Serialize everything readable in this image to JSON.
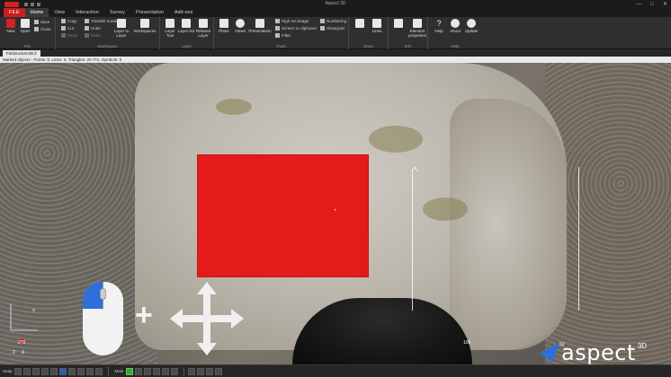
{
  "window": {
    "title": "Aspect 3D",
    "controls": [
      "—",
      "□",
      "✕"
    ]
  },
  "tabs": [
    {
      "label": "FILE"
    },
    {
      "label": "Home"
    },
    {
      "label": "View"
    },
    {
      "label": "Interaction"
    },
    {
      "label": "Survey"
    },
    {
      "label": "Presentation"
    },
    {
      "label": "Add-ons"
    }
  ],
  "ribbon": {
    "groups": {
      "file": {
        "title": "Info",
        "new": "New",
        "open": "Open",
        "save": "Save",
        "close": "Close"
      },
      "workspace": {
        "title": "Workspace",
        "copy": "Copy",
        "cut": "Cut",
        "paste": "Paste",
        "undo": "Undo",
        "redo": "Redo",
        "transfer": "Transfer mode",
        "layers": "Layer to Layer",
        "workspaces": "Workspaces"
      },
      "layer": {
        "title": "Layer",
        "layer_tool": "Layer Tool",
        "layer_list": "Layer list",
        "release_layer": "Release Layer"
      },
      "tools": {
        "title": "Tools",
        "plane": "Plane",
        "views": "Views",
        "presentation": "Presentation",
        "highres": "High res image",
        "screen_clip": "Screen to clipboard",
        "filter": "Filter",
        "numbering": "Numbering",
        "histogram": "Histogram"
      },
      "draw": {
        "title": "Draw",
        "draw": "",
        "lines": "Lines"
      },
      "info": {
        "title": "Info",
        "element_props": "Element properties"
      },
      "help": {
        "title": "Help",
        "help": "Help",
        "about": "About",
        "update": "Update"
      }
    }
  },
  "document": {
    "tab_label": "Felsbrocken3D.ll",
    "info": "Marked objects - Points: 0, Lines: 0, Triangles: 20 771, Symbols: 0"
  },
  "viewport": {
    "axis_labels": {
      "y": "Y",
      "x": "X",
      "z": "Z",
      "scale": "270"
    },
    "scale_left": "100",
    "scale_right": "50"
  },
  "brand": {
    "name": "aspect",
    "sup": "3D",
    "color": "#2f6fd8"
  },
  "bottombar": {
    "label_left": "Snap",
    "label_mid": "Mark"
  },
  "colors": {
    "accent_red": "#e31b1b",
    "file_tab": "#c81e1e",
    "mouse_button": "#2f6fd8"
  }
}
